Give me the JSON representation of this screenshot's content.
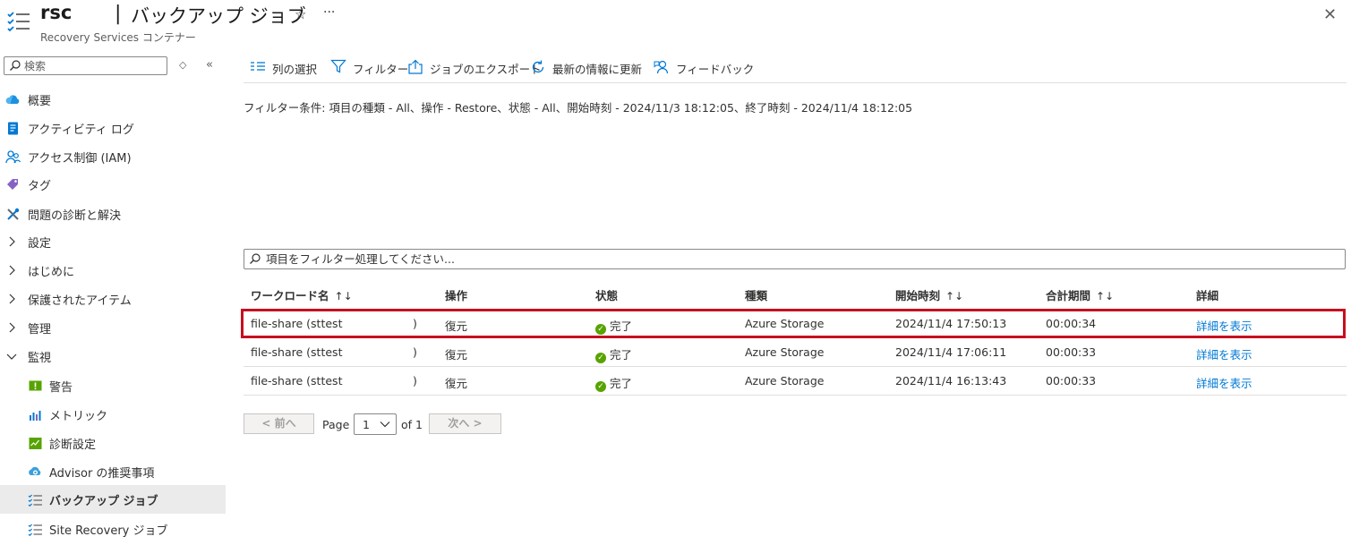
{
  "header": {
    "title": "rsc",
    "separator": "|",
    "page": "バックアップ ジョブ",
    "subtitle": "Recovery Services コンテナー",
    "star": "☆",
    "more": "···",
    "close": "✕"
  },
  "sidebar": {
    "search_placeholder": "検索",
    "updown": "◇",
    "collapse": "«",
    "items": [
      {
        "label": "概要",
        "icon": "cloud-icon"
      },
      {
        "label": "アクティビティ ログ",
        "icon": "activity-log-icon"
      },
      {
        "label": "アクセス制御 (IAM)",
        "icon": "people-icon"
      },
      {
        "label": "タグ",
        "icon": "tag-icon"
      },
      {
        "label": "問題の診断と解決",
        "icon": "wrench-icon"
      },
      {
        "label": "設定",
        "icon": "chevron-right-icon"
      },
      {
        "label": "はじめに",
        "icon": "chevron-right-icon"
      },
      {
        "label": "保護されたアイテム",
        "icon": "chevron-right-icon"
      },
      {
        "label": "管理",
        "icon": "chevron-right-icon"
      },
      {
        "label": "監視",
        "icon": "chevron-down-icon"
      },
      {
        "label": "警告",
        "icon": "alert-icon"
      },
      {
        "label": "メトリック",
        "icon": "metrics-icon"
      },
      {
        "label": "診断設定",
        "icon": "diagnostic-icon"
      },
      {
        "label": "Advisor の推奨事項",
        "icon": "advisor-icon"
      },
      {
        "label": "バックアップ ジョブ",
        "icon": "job-list-icon"
      },
      {
        "label": "Site Recovery ジョブ",
        "icon": "job-list-icon"
      }
    ]
  },
  "toolbar": {
    "columns": "列の選択",
    "filter": "フィルター",
    "export": "ジョブのエクスポート",
    "refresh": "最新の情報に更新",
    "feedback": "フィードバック"
  },
  "filter_condition": "フィルター条件: 項目の種類 - All、操作 - Restore、状態 - All、開始時刻 - 2024/11/3 18:12:05、終了時刻 - 2024/11/4 18:12:05",
  "filter_placeholder": "項目をフィルター処理してください...",
  "table": {
    "headers": {
      "workload": "ワークロード名",
      "operation": "操作",
      "status": "状態",
      "type": "種類",
      "start": "開始時刻",
      "duration": "合計期間",
      "details": "詳細"
    },
    "sort_glyph": "↑↓",
    "status_glyph": "✓",
    "rows": [
      {
        "name": "file-share (sttest",
        "paren": ")",
        "operation": "復元",
        "status": "完了",
        "type": "Azure Storage",
        "start": "2024/11/4 17:50:13",
        "duration": "00:00:34",
        "details": "詳細を表示"
      },
      {
        "name": "file-share (sttest",
        "paren": ")",
        "operation": "復元",
        "status": "完了",
        "type": "Azure Storage",
        "start": "2024/11/4 17:06:11",
        "duration": "00:00:33",
        "details": "詳細を表示"
      },
      {
        "name": "file-share (sttest",
        "paren": ")",
        "operation": "復元",
        "status": "完了",
        "type": "Azure Storage",
        "start": "2024/11/4 16:13:43",
        "duration": "00:00:33",
        "details": "詳細を表示"
      }
    ]
  },
  "pagination": {
    "prev": "< 前へ",
    "page_label": "Page",
    "page_value": "1",
    "of_label": "of 1",
    "next": "次へ >"
  },
  "colors": {
    "accent": "#0078d4",
    "highlight": "#c50f1f",
    "success": "#57a300"
  }
}
